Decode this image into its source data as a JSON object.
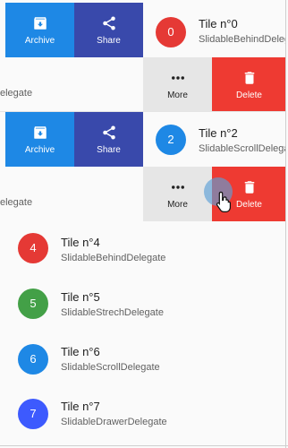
{
  "colors": {
    "archive": "#1e88e5",
    "share": "#3949ab",
    "more": "#e6e6e6",
    "delete": "#ee3a32",
    "red": "#e53935",
    "blue": "#1e88e5",
    "green": "#43a047",
    "indigo": "#3d5afe"
  },
  "actions": {
    "archive": "Archive",
    "share": "Share",
    "more": "More",
    "delete": "Delete"
  },
  "icons": {
    "archive": "archive-icon",
    "share": "share-icon",
    "more": "more-horiz-icon",
    "delete": "trash-icon",
    "cursor": "hand-pointer-icon"
  },
  "tiles": [
    {
      "avatar": "0",
      "title": "Tile n°0",
      "subtitle": "SlidableBehindDelegate"
    },
    {
      "subtitle": "elegate"
    },
    {
      "avatar": "2",
      "title": "Tile n°2",
      "subtitle": "SlidableScrollDelegate"
    },
    {
      "subtitle": "elegate"
    },
    {
      "avatar": "4",
      "title": "Tile n°4",
      "subtitle": "SlidableBehindDelegate"
    },
    {
      "avatar": "5",
      "title": "Tile n°5",
      "subtitle": "SlidableStrechDelegate"
    },
    {
      "avatar": "6",
      "title": "Tile n°6",
      "subtitle": "SlidableScrollDelegate"
    },
    {
      "avatar": "7",
      "title": "Tile n°7",
      "subtitle": "SlidableDrawerDelegate"
    }
  ]
}
